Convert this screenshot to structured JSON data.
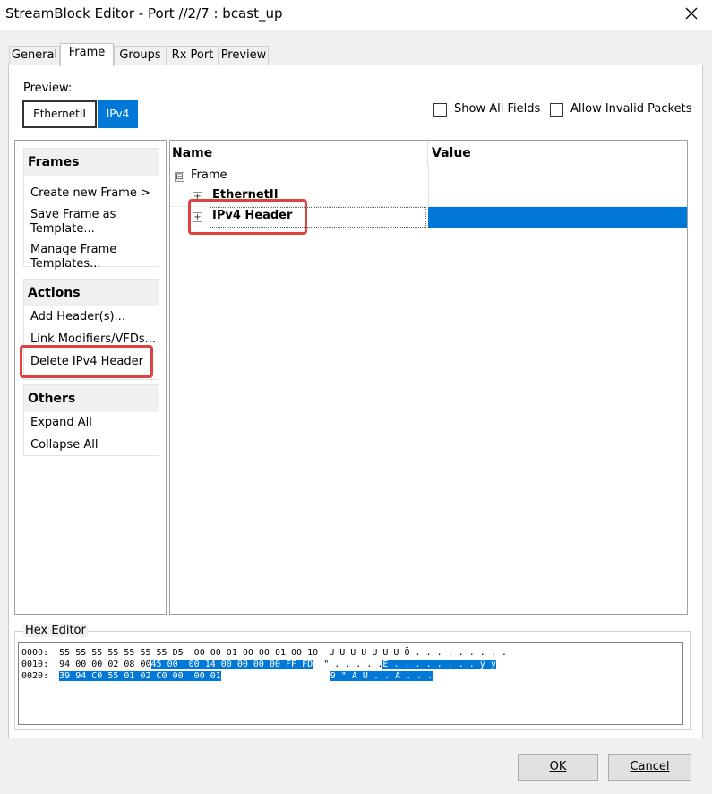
{
  "window": {
    "title": "StreamBlock Editor - Port //2/7 : bcast_up"
  },
  "tabs": [
    {
      "label": "General"
    },
    {
      "label": "Frame"
    },
    {
      "label": "Groups"
    },
    {
      "label": "Rx Port"
    },
    {
      "label": "Preview"
    }
  ],
  "preview": {
    "label": "Preview:",
    "buttons": [
      {
        "label": "EthernetII"
      },
      {
        "label": "IPv4"
      }
    ]
  },
  "options": {
    "show_all_fields": {
      "label": "Show All Fields",
      "checked": false
    },
    "allow_invalid_packets": {
      "label": "Allow Invalid Packets",
      "checked": false
    }
  },
  "sidebar": {
    "frames": {
      "title": "Frames",
      "items": [
        {
          "label": "Create new Frame >"
        },
        {
          "label": "Save Frame as"
        },
        {
          "label": "Template..."
        },
        {
          "label": "Manage Frame"
        },
        {
          "label": "Templates..."
        }
      ]
    },
    "actions": {
      "title": "Actions",
      "items": [
        {
          "label": "Add Header(s)..."
        },
        {
          "label": "Link Modifiers/VFDs..."
        },
        {
          "label": "Delete IPv4 Header"
        }
      ]
    },
    "others": {
      "title": "Others",
      "items": [
        {
          "label": "Expand All"
        },
        {
          "label": "Collapse All"
        }
      ]
    }
  },
  "tree": {
    "columns": {
      "name": "Name",
      "value": "Value"
    },
    "root": {
      "label": "Frame",
      "expander": "⊟"
    },
    "children": [
      {
        "label": "EthernetII",
        "expander": "+"
      },
      {
        "label": "IPv4 Header",
        "expander": "+"
      }
    ]
  },
  "hex_editor": {
    "label": "Hex Editor",
    "lines": [
      {
        "offset": "0000:",
        "hex_a": "55 55 55 55 55 55 55 D5  00 00 01 00 00 01 00 10",
        "hex_b": "",
        "ascii_a": "U U U U U U U Õ . . . . . . . . .",
        "ascii_b": ""
      },
      {
        "offset": "0010:",
        "hex_a": "94 00 00 02 08 00",
        "hex_b": "45 00  00 14 00 00 00 00 FF FD",
        "ascii_a": "\" . . . . .",
        "ascii_b": "E . . . . . . . . ÿ ý"
      },
      {
        "offset": "0020:",
        "hex_a": "",
        "hex_b": "39 94 C0 55 01 02 C0 00  00 01",
        "ascii_a": "",
        "ascii_b": "9 \" À U . . À . . ."
      }
    ]
  },
  "footer": {
    "ok_label": "OK",
    "cancel_label": "Cancel"
  },
  "colors": {
    "accent": "#0078d7",
    "highlight_box": "#e04040"
  }
}
